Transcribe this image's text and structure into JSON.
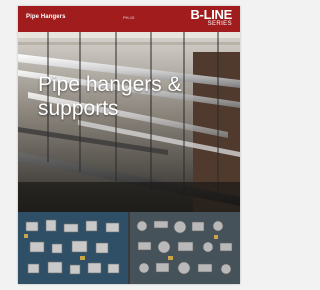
{
  "cover": {
    "section_label": "Pipe Hangers",
    "page_code": "PH-10",
    "brand_name": "B-LINE",
    "brand_series": "SERIES",
    "title_line1": "Pipe hangers &",
    "title_line2": "supports"
  },
  "colors": {
    "header_red": "#a11d1d",
    "background": "#f2f2f2"
  }
}
